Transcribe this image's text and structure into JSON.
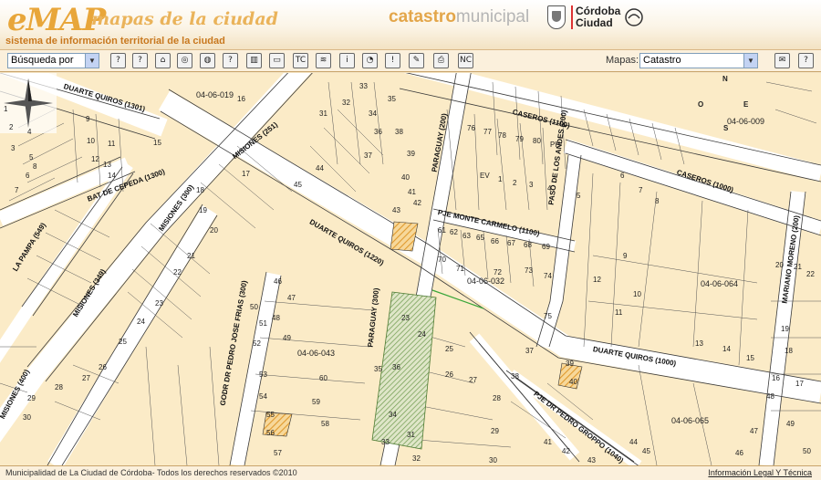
{
  "header": {
    "logo": "eMAP",
    "logo_tagline": "mapas de la ciudad",
    "subtitle": "sistema de información territorial de la ciudad",
    "catastro_bold": "catastro",
    "catastro_rest": "municipal",
    "city_line1": "Córdoba",
    "city_line2": "Ciudad",
    "accent_color": "#e8a63a"
  },
  "toolbar": {
    "search_select": "Búsqueda por",
    "maps_label": "Mapas:",
    "map_select": "Catastro",
    "tools": [
      {
        "icon": "?",
        "name": "help-query-icon"
      },
      {
        "icon": "?",
        "name": "info-query-icon"
      },
      {
        "icon": "⌂",
        "name": "home-view-icon"
      },
      {
        "icon": "◎",
        "name": "target-icon"
      },
      {
        "icon": "◍",
        "name": "globe-icon"
      },
      {
        "icon": "?",
        "name": "identify-icon"
      },
      {
        "icon": "▥",
        "name": "layers-icon"
      },
      {
        "icon": "▭",
        "name": "frame-icon"
      },
      {
        "icon": "TC",
        "name": "tc-icon"
      },
      {
        "icon": "≋",
        "name": "terrain-icon"
      },
      {
        "icon": "i",
        "name": "info-icon"
      },
      {
        "icon": "◔",
        "name": "measure-icon"
      },
      {
        "icon": "!",
        "name": "alert-icon"
      },
      {
        "icon": "✎",
        "name": "edit-icon"
      },
      {
        "icon": "⎙",
        "name": "print-icon"
      },
      {
        "icon": "NC",
        "name": "nc-icon"
      }
    ],
    "mail_icon": "mail-icon",
    "help_icon": "help-icon"
  },
  "map": {
    "compass": {
      "n": "N",
      "s": "S",
      "e": "E",
      "o": "O"
    },
    "streets": [
      {
        "text": "DUARTE QUIROS (1301)"
      },
      {
        "text": "MISIONES (251)"
      },
      {
        "text": "BAT DE CEPEDA (1300)"
      },
      {
        "text": "MISIONES (300)"
      },
      {
        "text": "LA PAMPA (549)"
      },
      {
        "text": "MISIONES (349)"
      },
      {
        "text": "MISIONES (400)"
      },
      {
        "text": "DUARTE QUIROS (1220)"
      },
      {
        "text": "PARAGUAY (200)"
      },
      {
        "text": "PJE MONTE CARMELO (1100)"
      },
      {
        "text": "PASO DE LOS ANDES (200)"
      },
      {
        "text": "CASEROS (1100)"
      },
      {
        "text": "CASEROS (1000)"
      },
      {
        "text": "PARAGUAY (300)"
      },
      {
        "text": "GODR DR PEDRO JOSE FRIAS (300)"
      },
      {
        "text": "DUARTE QUIROS (1000)"
      },
      {
        "text": "PJE DR PEDRO GROPPO (1040)"
      },
      {
        "text": "MARIANO MORENO (200)"
      }
    ],
    "blocks": [
      "04-06-019",
      "04-06-009",
      "04-06-032",
      "04-06-064",
      "04-06-043",
      "04-06-065"
    ],
    "parcels": [
      "1",
      "2",
      "3",
      "4",
      "5",
      "6",
      "7",
      "8",
      "9",
      "10",
      "11",
      "12",
      "13",
      "14",
      "15",
      "16",
      "17",
      "18",
      "19",
      "20",
      "21",
      "22",
      "23",
      "24",
      "25",
      "26",
      "27",
      "28",
      "29",
      "30",
      "31",
      "32",
      "33",
      "34",
      "35",
      "36",
      "37",
      "38",
      "39",
      "40",
      "41",
      "42",
      "43",
      "44",
      "45",
      "46",
      "47",
      "48",
      "49",
      "50",
      "51",
      "52",
      "53",
      "54",
      "55",
      "56",
      "57",
      "58",
      "59",
      "60",
      "61",
      "62",
      "63",
      "65",
      "66",
      "67",
      "68",
      "69",
      "70",
      "71",
      "72",
      "73",
      "74",
      "75",
      "76",
      "77",
      "78",
      "79",
      "80",
      "PH",
      "EV"
    ],
    "colors": {
      "parcel": "#fbebc7",
      "street": "#ffffff",
      "line": "#333333",
      "green": "#6e9a4e",
      "highlight": "#e5a33b"
    }
  },
  "footer": {
    "copyright": "Municipalidad de La Ciudad de Córdoba- Todos los derechos reservados ©2010",
    "legal": "Información Legal Y Técnica"
  }
}
